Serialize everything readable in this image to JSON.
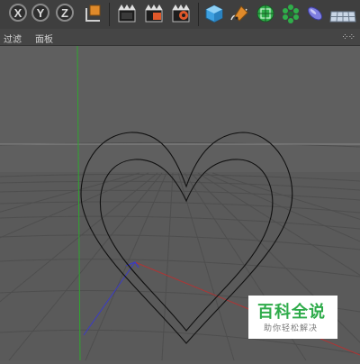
{
  "toolbar": {
    "axis_buttons": [
      {
        "label": "X",
        "name": "x-axis-lock-button"
      },
      {
        "label": "Y",
        "name": "y-axis-lock-button"
      },
      {
        "label": "Z",
        "name": "z-axis-lock-button"
      }
    ],
    "icons": [
      "coordinate-system-icon",
      "render-view-icon",
      "render-to-picture-viewer-icon",
      "render-settings-icon",
      "cube-icon",
      "pen-spline-icon",
      "subdivision-surface-icon",
      "cloner-icon",
      "deformer-icon",
      "floor-icon"
    ]
  },
  "menubar": {
    "items": [
      "过滤",
      "面板"
    ],
    "grip": "⁘⁘"
  },
  "watermark": {
    "logo": "百科全说",
    "tagline": "助你轻松解决"
  },
  "colors": {
    "viewport_bg": "#5d5d5d",
    "grid_line": "#4f4f4f",
    "horizon_line": "#8a8a8a",
    "y_axis": "#2fa62f",
    "x_axis": "#b03434",
    "z_axis": "#3a3ac8",
    "spline": "#111111",
    "watermark_green": "#2eab4a"
  }
}
